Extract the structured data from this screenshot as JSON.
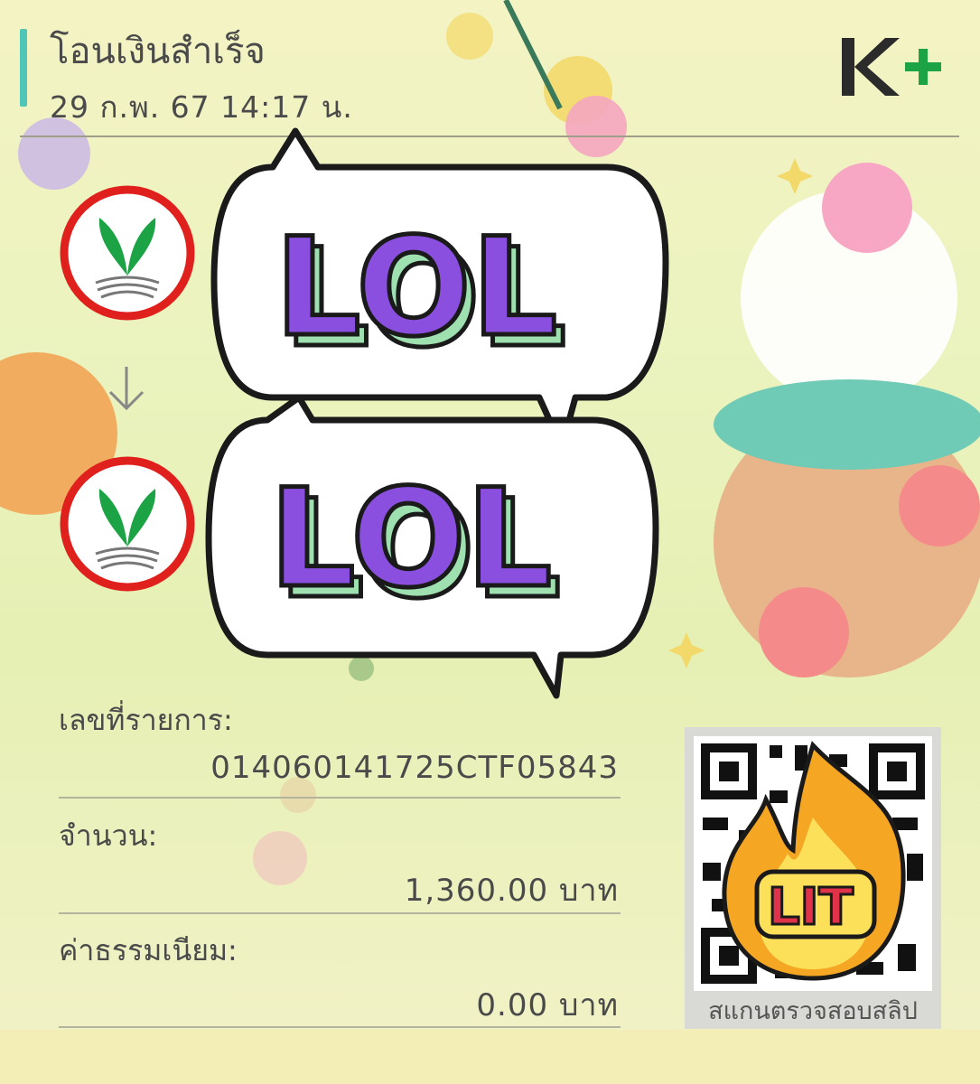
{
  "header": {
    "title": "โอนเงินสำเร็จ",
    "datetime": "29 ก.พ. 67  14:17 น.",
    "logo_icon": "kplus-logo"
  },
  "stickers": [
    {
      "text": "LOL",
      "icon": "lol-speech-bubble-sticker"
    },
    {
      "text": "LOL",
      "icon": "lol-speech-bubble-sticker"
    },
    {
      "text": "LIT",
      "icon": "fire-sticker"
    }
  ],
  "transfer": {
    "sender_icon": "kbank-logo",
    "arrow_icon": "arrow-down-icon",
    "receiver_icon": "kbank-logo"
  },
  "details": {
    "ref_label": "เลขที่รายการ:",
    "ref_value": "014060141725CTF05843",
    "amount_label": "จำนวน:",
    "amount_value": "1,360.00 บาท",
    "fee_label": "ค่าธรรมเนียม:",
    "fee_value": "0.00 บาท"
  },
  "qr": {
    "caption": "สแกนตรวจสอบสลิป",
    "icon": "qr-code-icon"
  },
  "colors": {
    "accent": "#4fc6b8",
    "kbank_green": "#1ba345",
    "kbank_red": "#e0201c",
    "lol_purple": "#8b4fe0",
    "lol_mint": "#9fe0b0",
    "fire_orange": "#f5a623"
  }
}
